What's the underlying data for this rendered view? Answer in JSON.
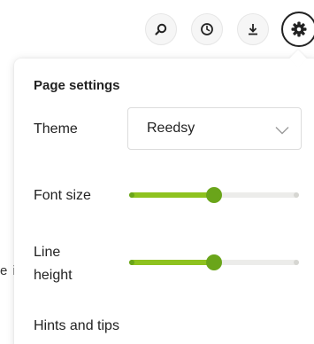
{
  "background": {
    "fragment_text": "e i"
  },
  "toolbar": {
    "buttons": [
      {
        "icon": "search-icon",
        "active": false
      },
      {
        "icon": "history-icon",
        "active": false
      },
      {
        "icon": "download-icon",
        "active": false
      },
      {
        "icon": "gear-icon",
        "active": true
      }
    ]
  },
  "panel": {
    "title": "Page settings",
    "theme": {
      "label": "Theme",
      "selected": "Reedsy",
      "icon": "chevron-down-icon"
    },
    "font_size": {
      "label": "Font size",
      "value_fraction": 0.5
    },
    "line_height": {
      "label_line1": "Line",
      "label_line2": "height",
      "value_fraction": 0.5
    },
    "hints": {
      "label": "Hints and tips"
    }
  },
  "colors": {
    "slider_fill": "#8ec21f",
    "slider_thumb": "#6aa51a",
    "slider_track": "#ececea"
  }
}
